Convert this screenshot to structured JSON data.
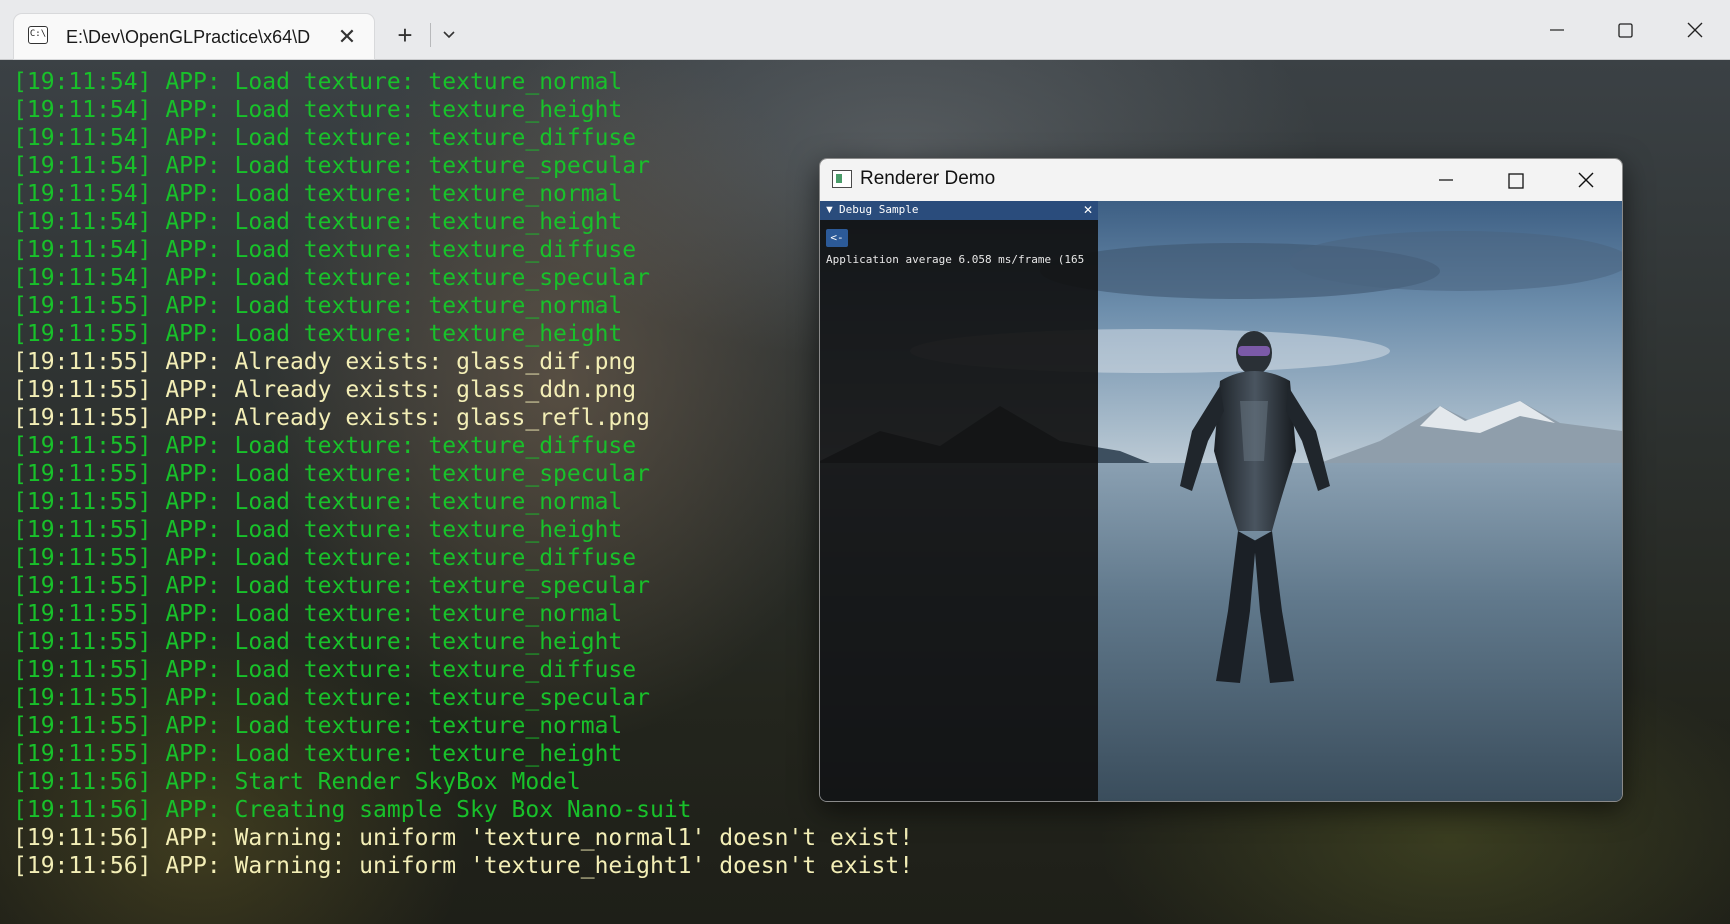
{
  "terminal_window": {
    "tab_title": "E:\\Dev\\OpenGLPractice\\x64\\D",
    "tab_icon": "terminal-icon",
    "new_tab_glyph": "+",
    "close_glyph": "✕",
    "log_lines": [
      {
        "text": "[19:11:54] APP: Load texture: texture_normal",
        "color": "green"
      },
      {
        "text": "[19:11:54] APP: Load texture: texture_height",
        "color": "green"
      },
      {
        "text": "[19:11:54] APP: Load texture: texture_diffuse",
        "color": "green"
      },
      {
        "text": "[19:11:54] APP: Load texture: texture_specular",
        "color": "green"
      },
      {
        "text": "[19:11:54] APP: Load texture: texture_normal",
        "color": "green"
      },
      {
        "text": "[19:11:54] APP: Load texture: texture_height",
        "color": "green"
      },
      {
        "text": "[19:11:54] APP: Load texture: texture_diffuse",
        "color": "green"
      },
      {
        "text": "[19:11:54] APP: Load texture: texture_specular",
        "color": "green"
      },
      {
        "text": "[19:11:55] APP: Load texture: texture_normal",
        "color": "green"
      },
      {
        "text": "[19:11:55] APP: Load texture: texture_height",
        "color": "green"
      },
      {
        "text": "[19:11:55] APP: Already exists: glass_dif.png",
        "color": "yellow"
      },
      {
        "text": "[19:11:55] APP: Already exists: glass_ddn.png",
        "color": "yellow"
      },
      {
        "text": "[19:11:55] APP: Already exists: glass_refl.png",
        "color": "yellow"
      },
      {
        "text": "[19:11:55] APP: Load texture: texture_diffuse",
        "color": "green"
      },
      {
        "text": "[19:11:55] APP: Load texture: texture_specular",
        "color": "green"
      },
      {
        "text": "[19:11:55] APP: Load texture: texture_normal",
        "color": "green"
      },
      {
        "text": "[19:11:55] APP: Load texture: texture_height",
        "color": "green"
      },
      {
        "text": "[19:11:55] APP: Load texture: texture_diffuse",
        "color": "green"
      },
      {
        "text": "[19:11:55] APP: Load texture: texture_specular",
        "color": "green"
      },
      {
        "text": "[19:11:55] APP: Load texture: texture_normal",
        "color": "green"
      },
      {
        "text": "[19:11:55] APP: Load texture: texture_height",
        "color": "green"
      },
      {
        "text": "[19:11:55] APP: Load texture: texture_diffuse",
        "color": "green"
      },
      {
        "text": "[19:11:55] APP: Load texture: texture_specular",
        "color": "green"
      },
      {
        "text": "[19:11:55] APP: Load texture: texture_normal",
        "color": "green"
      },
      {
        "text": "[19:11:55] APP: Load texture: texture_height",
        "color": "green"
      },
      {
        "text": "[19:11:56] APP: Start Render SkyBox Model",
        "color": "green"
      },
      {
        "text": "[19:11:56] APP: Creating sample Sky Box Nano-suit",
        "color": "green"
      },
      {
        "text": "[19:11:56] APP: Warning: uniform 'texture_normal1' doesn't exist!",
        "color": "yellow"
      },
      {
        "text": "[19:11:56] APP: Warning: uniform 'texture_height1' doesn't exist!",
        "color": "yellow"
      }
    ],
    "colors": {
      "green": "#18c12a",
      "yellow": "#f3eeb6"
    }
  },
  "renderer_window": {
    "title": "Renderer Demo",
    "app_icon": "application-window-icon",
    "debug_panel": {
      "title": "Debug Sample",
      "collapse_glyph": "▼",
      "close_glyph": "✕",
      "back_button_label": "<-",
      "stats_text": "Application average 6.058 ms/frame (165"
    },
    "scene_elements": [
      "skybox-lake-mountains",
      "nanosuit-model"
    ]
  }
}
